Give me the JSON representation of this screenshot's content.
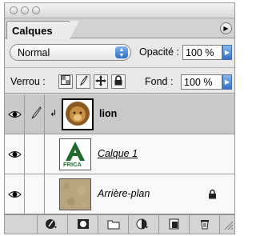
{
  "panel": {
    "tab_label": "Calques",
    "blend_mode": "Normal",
    "opacity_label": "Opacité :",
    "opacity_value": "100 %",
    "lock_label": "Verrou :",
    "fill_label": "Fond :",
    "fill_value": "100 %"
  },
  "lock_icons": [
    "lock-transparency-icon",
    "lock-brush-icon",
    "lock-move-icon",
    "lock-all-icon"
  ],
  "layers": [
    {
      "name": "lion",
      "visible": true,
      "selected": true,
      "clipped": true,
      "thumbnail": "lion-head"
    },
    {
      "name": "Calque 1",
      "visible": true,
      "selected": false,
      "underlined": true,
      "thumbnail": "africa-logo",
      "thumb_text": "FRICA"
    },
    {
      "name": "Arrière-plan",
      "visible": true,
      "selected": false,
      "italic": true,
      "locked": true,
      "thumbnail": "beige-texture"
    }
  ],
  "bottom_icons": [
    "layer-style-icon",
    "layer-mask-icon",
    "new-group-icon",
    "adjustment-layer-icon",
    "new-layer-icon",
    "trash-icon"
  ]
}
